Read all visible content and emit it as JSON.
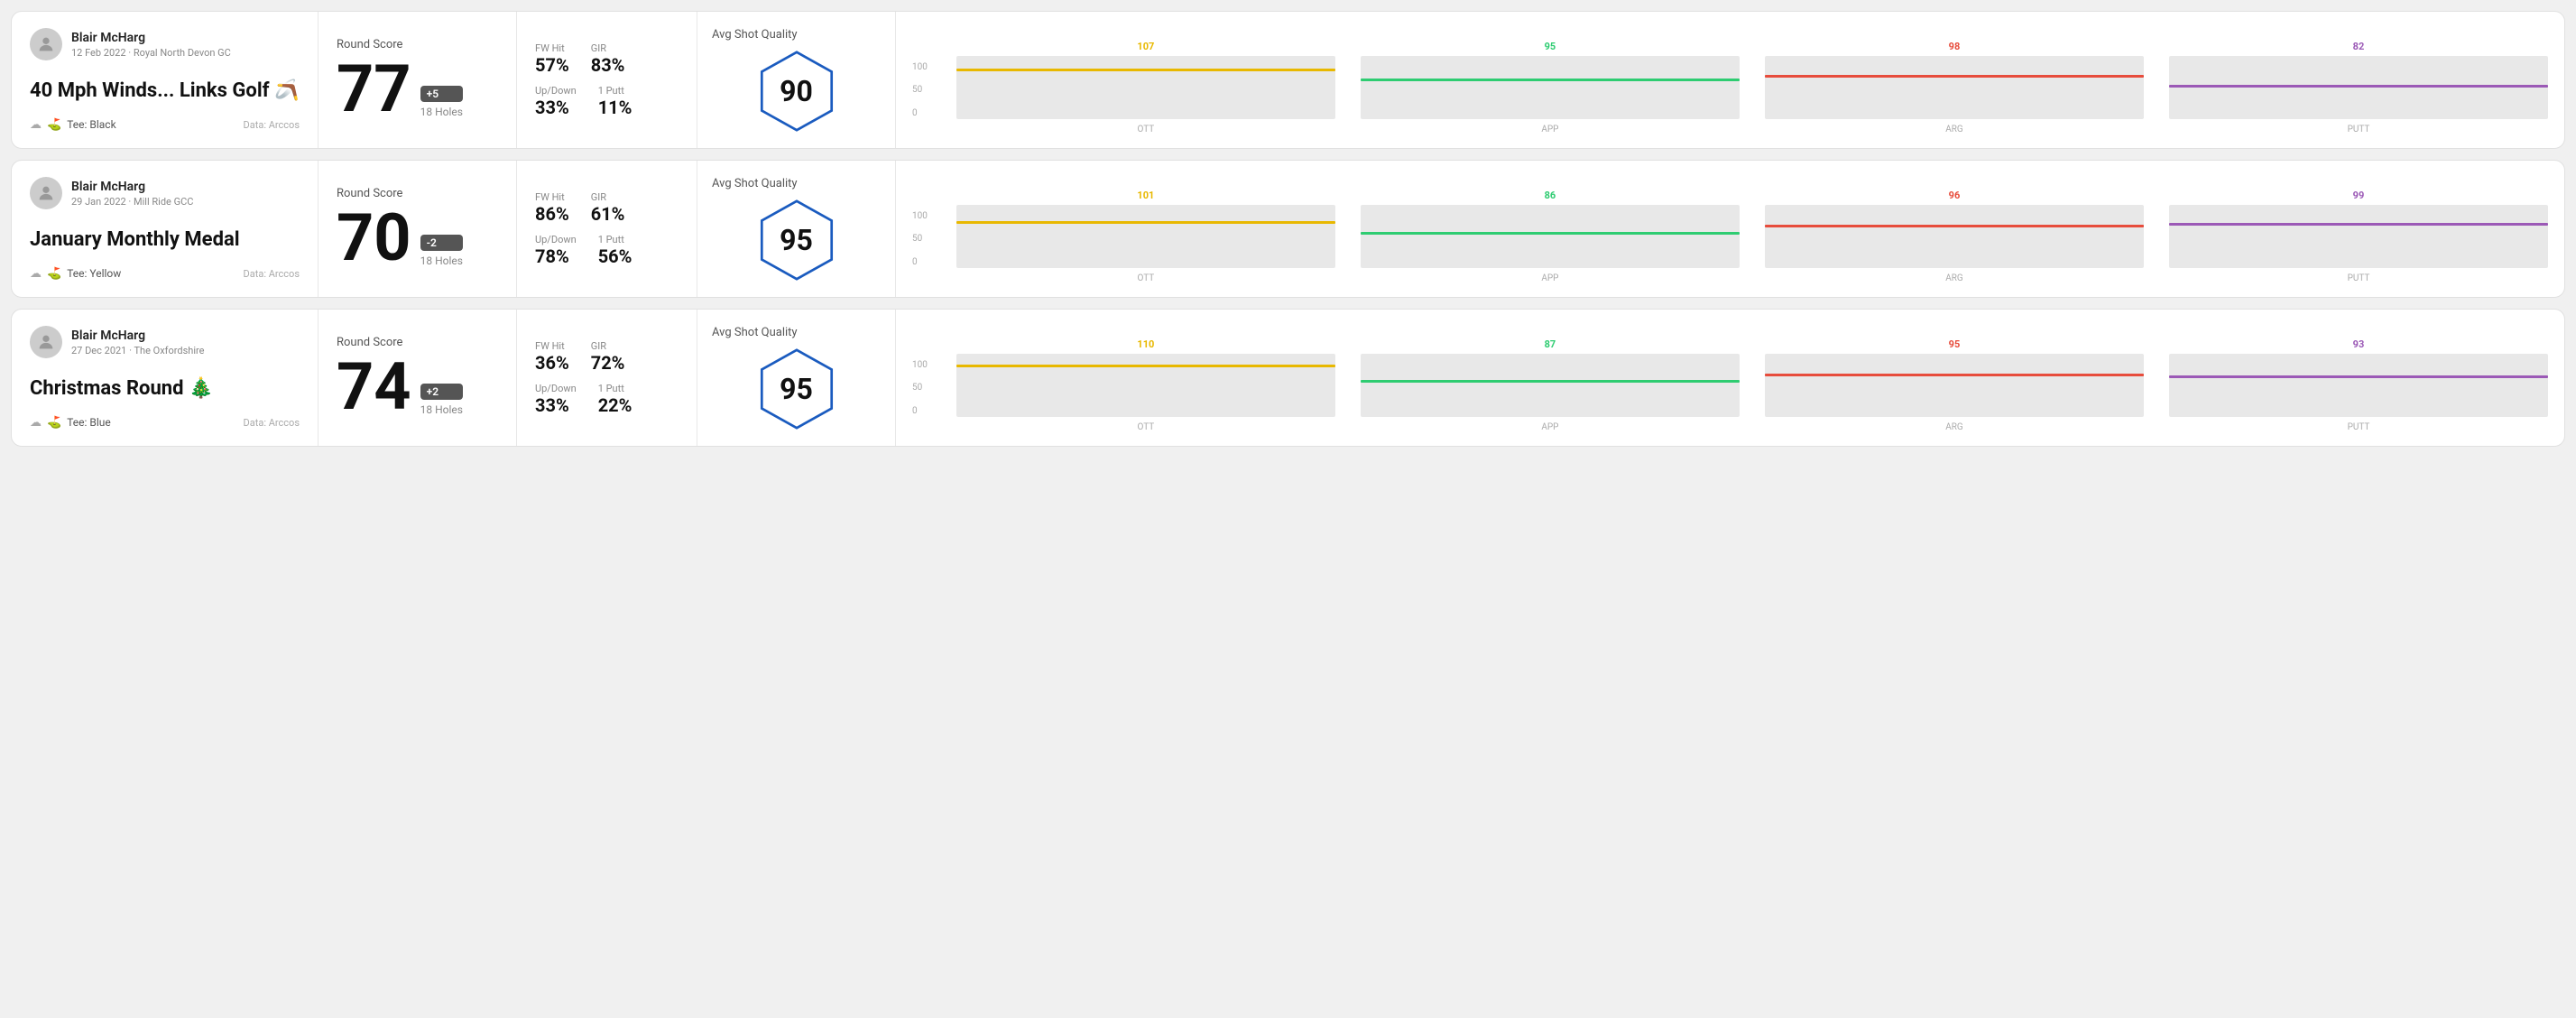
{
  "rounds": [
    {
      "player": "Blair McHarg",
      "date_course": "12 Feb 2022 · Royal North Devon GC",
      "title": "40 Mph Winds... Links Golf 🪃",
      "tee": "Black",
      "data_source": "Data: Arccos",
      "round_score_label": "Round Score",
      "score": "77",
      "score_diff": "+5",
      "score_holes": "18 Holes",
      "fw_hit_label": "FW Hit",
      "fw_hit": "57%",
      "gir_label": "GIR",
      "gir": "83%",
      "updown_label": "Up/Down",
      "updown": "33%",
      "oneputt_label": "1 Putt",
      "oneputt": "11%",
      "avg_shot_quality_label": "Avg Shot Quality",
      "quality_score": "90",
      "chart": {
        "columns": [
          {
            "label": "OTT",
            "value": 107,
            "color": "#e8b800",
            "bar_pct": 75
          },
          {
            "label": "APP",
            "value": 95,
            "color": "#2ecc71",
            "bar_pct": 60
          },
          {
            "label": "ARG",
            "value": 98,
            "color": "#e74c3c",
            "bar_pct": 65
          },
          {
            "label": "PUTT",
            "value": 82,
            "color": "#9b59b6",
            "bar_pct": 50
          }
        ]
      }
    },
    {
      "player": "Blair McHarg",
      "date_course": "29 Jan 2022 · Mill Ride GCC",
      "title": "January Monthly Medal",
      "tee": "Yellow",
      "data_source": "Data: Arccos",
      "round_score_label": "Round Score",
      "score": "70",
      "score_diff": "-2",
      "score_holes": "18 Holes",
      "fw_hit_label": "FW Hit",
      "fw_hit": "86%",
      "gir_label": "GIR",
      "gir": "61%",
      "updown_label": "Up/Down",
      "updown": "78%",
      "oneputt_label": "1 Putt",
      "oneputt": "56%",
      "avg_shot_quality_label": "Avg Shot Quality",
      "quality_score": "95",
      "chart": {
        "columns": [
          {
            "label": "OTT",
            "value": 101,
            "color": "#e8b800",
            "bar_pct": 70
          },
          {
            "label": "APP",
            "value": 86,
            "color": "#2ecc71",
            "bar_pct": 52
          },
          {
            "label": "ARG",
            "value": 96,
            "color": "#e74c3c",
            "bar_pct": 63
          },
          {
            "label": "PUTT",
            "value": 99,
            "color": "#9b59b6",
            "bar_pct": 66
          }
        ]
      }
    },
    {
      "player": "Blair McHarg",
      "date_course": "27 Dec 2021 · The Oxfordshire",
      "title": "Christmas Round 🎄",
      "tee": "Blue",
      "data_source": "Data: Arccos",
      "round_score_label": "Round Score",
      "score": "74",
      "score_diff": "+2",
      "score_holes": "18 Holes",
      "fw_hit_label": "FW Hit",
      "fw_hit": "36%",
      "gir_label": "GIR",
      "gir": "72%",
      "updown_label": "Up/Down",
      "updown": "33%",
      "oneputt_label": "1 Putt",
      "oneputt": "22%",
      "avg_shot_quality_label": "Avg Shot Quality",
      "quality_score": "95",
      "chart": {
        "columns": [
          {
            "label": "OTT",
            "value": 110,
            "color": "#e8b800",
            "bar_pct": 78
          },
          {
            "label": "APP",
            "value": 87,
            "color": "#2ecc71",
            "bar_pct": 53
          },
          {
            "label": "ARG",
            "value": 95,
            "color": "#e74c3c",
            "bar_pct": 63
          },
          {
            "label": "PUTT",
            "value": 93,
            "color": "#9b59b6",
            "bar_pct": 61
          }
        ]
      }
    }
  ]
}
